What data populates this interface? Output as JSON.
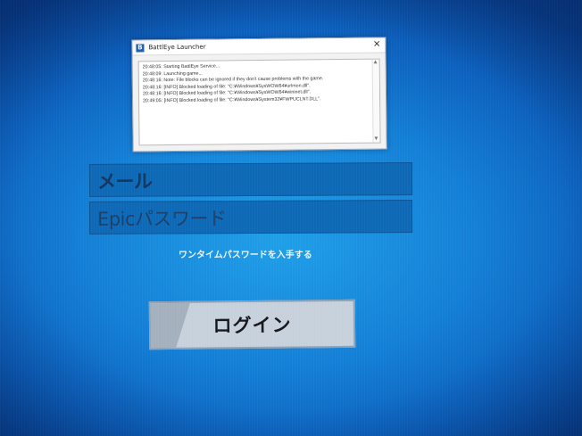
{
  "battleye": {
    "title": "BattlEye Launcher",
    "icon": "battleye-logo-icon",
    "close_icon": "close-icon",
    "log_lines": [
      "20:48:05: Starting BattlEye Service...",
      "20:48:09: Launching game...",
      "20:48:16: Note: File blocks can be ignored if they don't cause problems with the game.",
      "20:48:16: [INFO] Blocked loading of file: \"C:¥Windows¥SysWOW64¥urlmon.dll\".",
      "20:48:16: [INFO] Blocked loading of file: \"C:¥Windows¥SysWOW64¥wininet.dll\".",
      "20:49:05: [INFO] Blocked loading of file: \"C:¥Windows¥System32¥FWPUCLNT.DLL\"."
    ]
  },
  "login": {
    "email_placeholder": "メール",
    "password_placeholder": "Epicパスワード",
    "otp_link": "ワンタイムパスワードを入手する",
    "login_button": "ログイン"
  },
  "colors": {
    "background": "#137fd6",
    "field": "#0d69b5",
    "button": "#c7d1dc"
  }
}
